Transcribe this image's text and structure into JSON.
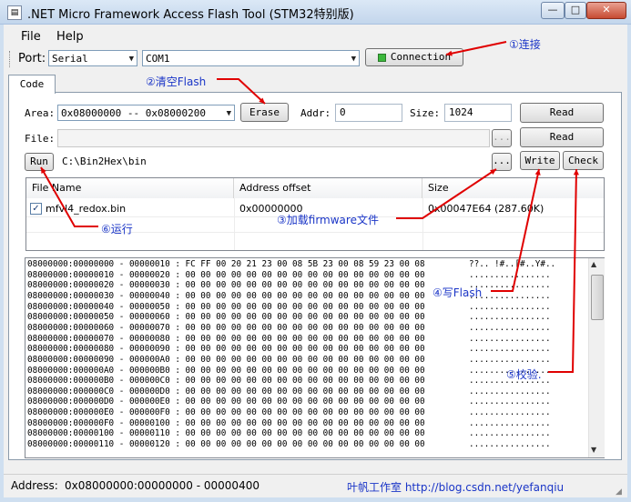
{
  "window": {
    "title": ".NET Micro Framework Access Flash Tool (STM32特别版)",
    "icon_glyph": "▤",
    "minimize_glyph": "—",
    "maximize_glyph": "□",
    "close_glyph": "✕"
  },
  "menu": {
    "items": [
      "File",
      "Help"
    ]
  },
  "toolbar": {
    "port_label": "Port:",
    "port_value": "Serial",
    "com_value": "COM1",
    "connection_label": "Connection"
  },
  "tab": {
    "label": "Code"
  },
  "form": {
    "area_label": "Area:",
    "area_value": "0x08000000 -- 0x08000200",
    "erase_label": "Erase",
    "addr_label": "Addr:",
    "addr_value": "0",
    "size_label": "Size:",
    "size_value": "1024",
    "read_label": "Read",
    "file_label": "File:",
    "file_value": "",
    "browse_label": "...",
    "read2_label": "Read",
    "run_label": "Run",
    "path_value": "C:\\Bin2Hex\\bin",
    "browse2_label": "...",
    "write_label": "Write",
    "check_label": "Check"
  },
  "filelist": {
    "headers": [
      "File Name",
      "Address offset",
      "Size"
    ],
    "rows": [
      {
        "checked": true,
        "name": "mfvl4_redox.bin",
        "offset": "0x00000000",
        "size": "0x00047E64 (287.60K)"
      }
    ]
  },
  "hexview": {
    "lines": [
      "08000000:00000000 - 00000010 : FC FF 00 20 21 23 00 08 5B 23 00 08 59 23 00 08",
      "08000000:00000010 - 00000020 : 00 00 00 00 00 00 00 00 00 00 00 00 00 00 00 00",
      "08000000:00000020 - 00000030 : 00 00 00 00 00 00 00 00 00 00 00 00 00 00 00 00",
      "08000000:00000030 - 00000040 : 00 00 00 00 00 00 00 00 00 00 00 00 00 00 00 00",
      "08000000:00000040 - 00000050 : 00 00 00 00 00 00 00 00 00 00 00 00 00 00 00 00",
      "08000000:00000050 - 00000060 : 00 00 00 00 00 00 00 00 00 00 00 00 00 00 00 00",
      "08000000:00000060 - 00000070 : 00 00 00 00 00 00 00 00 00 00 00 00 00 00 00 00",
      "08000000:00000070 - 00000080 : 00 00 00 00 00 00 00 00 00 00 00 00 00 00 00 00",
      "08000000:00000080 - 00000090 : 00 00 00 00 00 00 00 00 00 00 00 00 00 00 00 00",
      "08000000:00000090 - 000000A0 : 00 00 00 00 00 00 00 00 00 00 00 00 00 00 00 00",
      "08000000:000000A0 - 000000B0 : 00 00 00 00 00 00 00 00 00 00 00 00 00 00 00 00",
      "08000000:000000B0 - 000000C0 : 00 00 00 00 00 00 00 00 00 00 00 00 00 00 00 00",
      "08000000:000000C0 - 000000D0 : 00 00 00 00 00 00 00 00 00 00 00 00 00 00 00 00",
      "08000000:000000D0 - 000000E0 : 00 00 00 00 00 00 00 00 00 00 00 00 00 00 00 00",
      "08000000:000000E0 - 000000F0 : 00 00 00 00 00 00 00 00 00 00 00 00 00 00 00 00",
      "08000000:000000F0 - 00000100 : 00 00 00 00 00 00 00 00 00 00 00 00 00 00 00 00",
      "08000000:00000100 - 00000110 : 00 00 00 00 00 00 00 00 00 00 00 00 00 00 00 00",
      "08000000:00000110 - 00000120 : 00 00 00 00 00 00 00 00 00 00 00 00 00 00 00 00"
    ],
    "ascii": [
      "??.. !#..[#..Y#..",
      "................",
      "................",
      "................",
      "................",
      "................",
      "................",
      "................",
      "................",
      "................",
      "................",
      "................",
      "................",
      "................",
      "................",
      "................",
      "................",
      "................"
    ],
    "scroll_up_glyph": "▲",
    "scroll_down_glyph": "▼"
  },
  "annotations": {
    "connect": "①连接",
    "erase": "②清空Flash",
    "load": "③加载firmware文件",
    "write": "④写Flash",
    "check": "⑤校验.",
    "run": "⑥运行",
    "color": "#1a35c7",
    "arrow_color": "#e00000"
  },
  "statusbar": {
    "address_label": "Address:",
    "address_value": "0x08000000:00000000 - 00000400",
    "credit": "叶帆工作室 http://blog.csdn.net/yefanqiu"
  }
}
